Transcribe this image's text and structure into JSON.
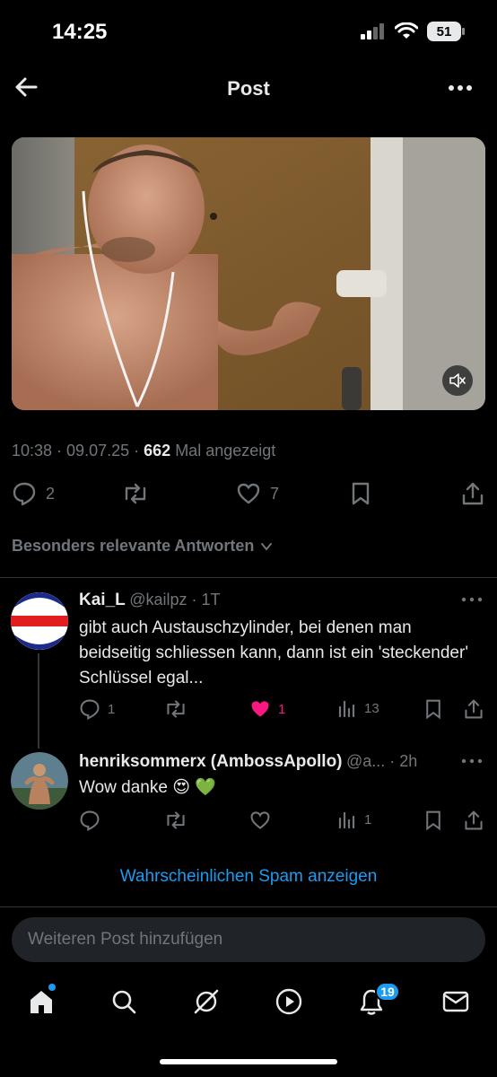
{
  "status_bar": {
    "time": "14:25",
    "battery": "51"
  },
  "header": {
    "title": "Post"
  },
  "post": {
    "time": "10:38",
    "date": "09.07.25",
    "views": "662",
    "views_label": "Mal angezeigt",
    "replies": "2",
    "likes": "7"
  },
  "relevant_label": "Besonders relevante Antworten",
  "replies": [
    {
      "name": "Kai_L",
      "handle": "@kailpz",
      "time": "1T",
      "text": "gibt auch Austauschzylinder, bei denen man beidseitig schliessen kann, dann ist ein 'steckender' Schlüssel egal...",
      "reply_count": "1",
      "like_count": "1",
      "view_count": "13",
      "liked": true
    },
    {
      "name": "henriksommerx (AmbossApollo)",
      "handle": "@a...",
      "time": "2h",
      "text": "Wow danke",
      "emoji": "😍 💚",
      "view_count": "1",
      "liked": false
    }
  ],
  "spam_link": "Wahrscheinlichen Spam anzeigen",
  "compose_placeholder": "Weiteren Post hinzufügen",
  "tabbar": {
    "notifications_badge": "19"
  },
  "colors": {
    "accent": "#1d9bf0",
    "like": "#f91880",
    "muted": "#71767b",
    "background": "#000000"
  }
}
